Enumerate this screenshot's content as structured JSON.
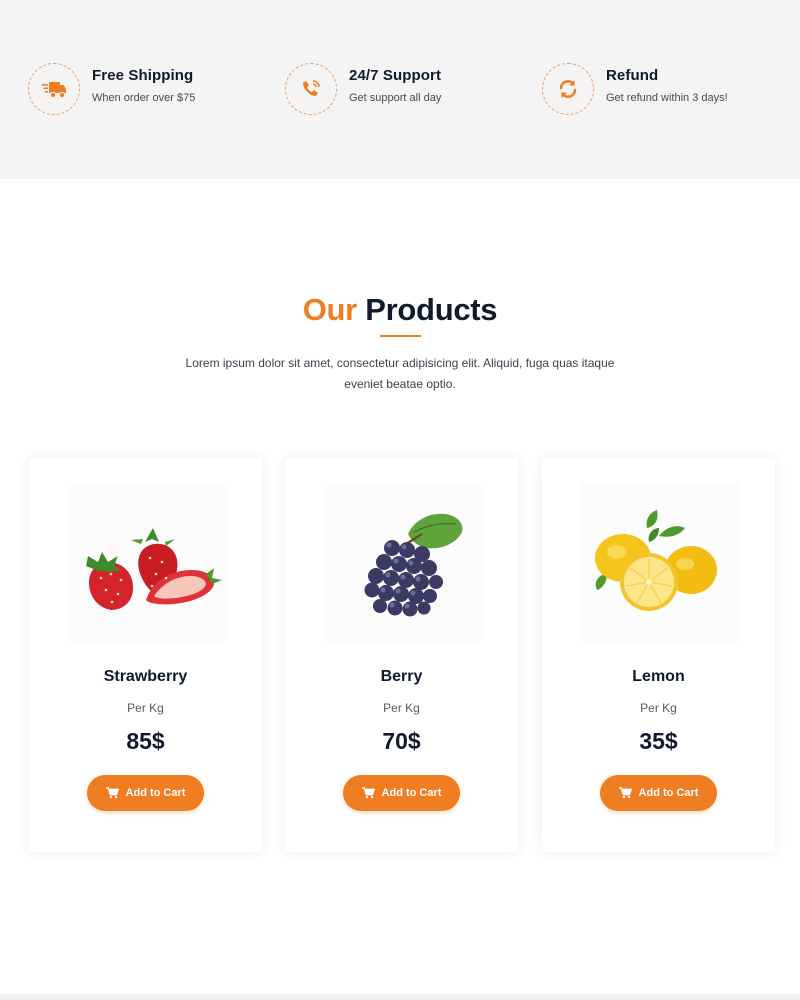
{
  "features": [
    {
      "icon": "delivery-truck-icon",
      "title": "Free Shipping",
      "subtitle": "When order over $75"
    },
    {
      "icon": "phone-icon",
      "title": "24/7 Support",
      "subtitle": "Get support all day"
    },
    {
      "icon": "refresh-icon",
      "title": "Refund",
      "subtitle": "Get refund within 3 days!"
    }
  ],
  "section": {
    "title_accent": "Our",
    "title_rest": "Products",
    "description": "Lorem ipsum dolor sit amet, consectetur adipisicing elit. Aliquid, fuga quas itaque eveniet beatae optio."
  },
  "products": [
    {
      "name": "Strawberry",
      "unit": "Per Kg",
      "price": "85$",
      "button": "Add to Cart",
      "image": "strawberry-image"
    },
    {
      "name": "Berry",
      "unit": "Per Kg",
      "price": "70$",
      "button": "Add to Cart",
      "image": "grape-image"
    },
    {
      "name": "Lemon",
      "unit": "Per Kg",
      "price": "35$",
      "button": "Add to Cart",
      "image": "lemon-image"
    }
  ],
  "colors": {
    "accent": "#ef7d22",
    "heading": "#0f1b2d",
    "band": "#f4f4f4"
  }
}
